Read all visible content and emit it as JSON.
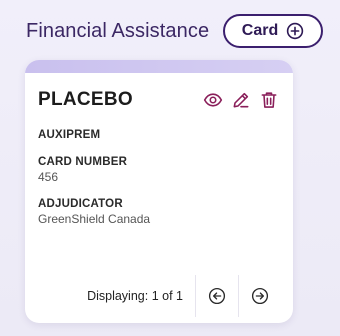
{
  "header": {
    "title": "Financial Assistance",
    "add_card_label": "Card",
    "add_icon": "plus-circle-icon"
  },
  "card": {
    "plan_name": "PLACEBO",
    "actions": [
      {
        "name": "view",
        "icon": "eye-icon"
      },
      {
        "name": "edit",
        "icon": "pencil-icon"
      },
      {
        "name": "delete",
        "icon": "trash-icon"
      }
    ],
    "program": "AUXIPREM",
    "card_number_label": "CARD NUMBER",
    "card_number_value": "456",
    "adjudicator_label": "ADJUDICATOR",
    "adjudicator_value": "GreenShield Canada"
  },
  "pagination": {
    "prefix": "Displaying:",
    "current": "1",
    "of_word": "of",
    "total": "1",
    "prev_icon": "arrow-left-circle-icon",
    "next_icon": "arrow-right-circle-icon"
  },
  "colors": {
    "accent": "#3b1f6e",
    "action_icons": "#8a1f5a",
    "card_strip": "#c9c0ee",
    "background": "#efedf8"
  }
}
